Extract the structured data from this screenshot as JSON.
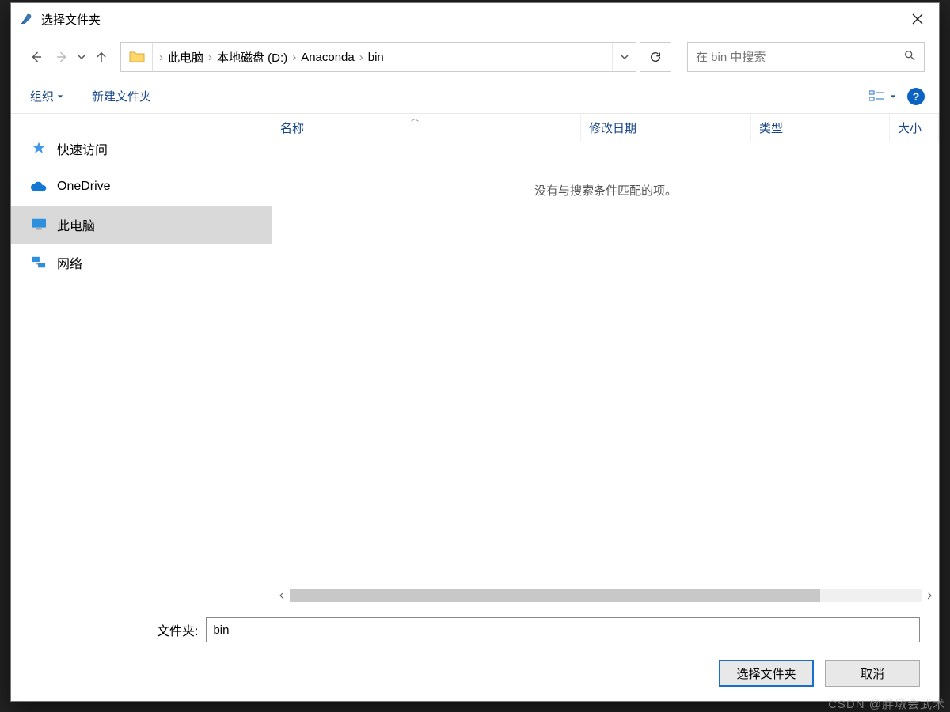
{
  "window": {
    "title": "选择文件夹"
  },
  "breadcrumb": {
    "items": [
      "此电脑",
      "本地磁盘 (D:)",
      "Anaconda",
      "bin"
    ]
  },
  "search": {
    "placeholder": "在 bin 中搜索"
  },
  "toolbar": {
    "organize": "组织",
    "new_folder": "新建文件夹"
  },
  "sidebar": {
    "items": [
      {
        "label": "快速访问"
      },
      {
        "label": "OneDrive"
      },
      {
        "label": "此电脑"
      },
      {
        "label": "网络"
      }
    ]
  },
  "columns": {
    "name": "名称",
    "date": "修改日期",
    "type": "类型",
    "size": "大小"
  },
  "list": {
    "empty": "没有与搜索条件匹配的项。"
  },
  "footer": {
    "label": "文件夹:",
    "value": "bin",
    "select": "选择文件夹",
    "cancel": "取消"
  },
  "watermark": "CSDN @胖墩会武术"
}
